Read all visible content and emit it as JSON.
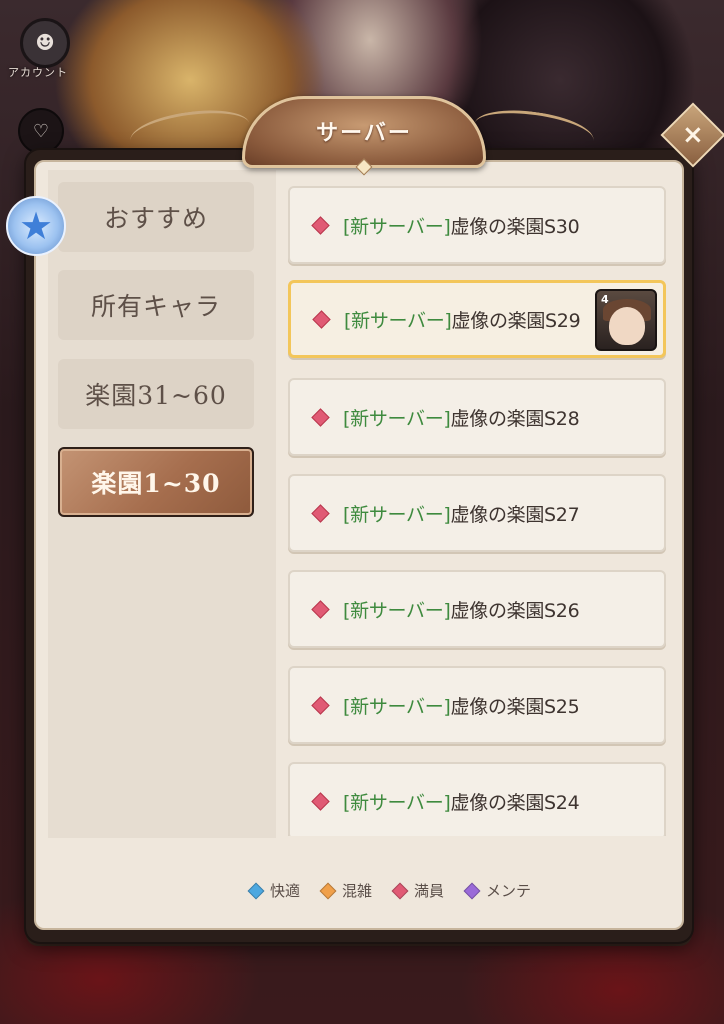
{
  "side": {
    "account_label": "アカウント",
    "heart_icon": "heart-icon",
    "star_icon": "star-icon"
  },
  "dialog": {
    "title": "サーバー",
    "close_label": "×"
  },
  "tabs": [
    {
      "label": "おすすめ",
      "active": false
    },
    {
      "label": "所有キャラ",
      "active": false
    },
    {
      "label": "楽園31~60",
      "active": false
    },
    {
      "label": "楽園1~30",
      "active": true
    }
  ],
  "servers": [
    {
      "tag": "[新サーバー]",
      "name": "虚像の楽園S30",
      "status": "full",
      "selected": false,
      "has_character": false
    },
    {
      "tag": "[新サーバー]",
      "name": "虚像の楽園S29",
      "status": "full",
      "selected": true,
      "has_character": true,
      "character_level": "4"
    },
    {
      "tag": "[新サーバー]",
      "name": "虚像の楽園S28",
      "status": "full",
      "selected": false,
      "has_character": false
    },
    {
      "tag": "[新サーバー]",
      "name": "虚像の楽園S27",
      "status": "full",
      "selected": false,
      "has_character": false
    },
    {
      "tag": "[新サーバー]",
      "name": "虚像の楽園S26",
      "status": "full",
      "selected": false,
      "has_character": false
    },
    {
      "tag": "[新サーバー]",
      "name": "虚像の楽園S25",
      "status": "full",
      "selected": false,
      "has_character": false
    },
    {
      "tag": "[新サーバー]",
      "name": "虚像の楽園S24",
      "status": "full",
      "selected": false,
      "has_character": false
    }
  ],
  "legend": [
    {
      "label": "快適",
      "color": "#4da8e0"
    },
    {
      "label": "混雑",
      "color": "#f0a04a"
    },
    {
      "label": "満員",
      "color": "#e05a74"
    },
    {
      "label": "メンテ",
      "color": "#9a6ad8"
    }
  ],
  "colors": {
    "status_full": "#e05a74",
    "new_tag": "#3e8a3e",
    "selected_border": "#f3c65a"
  }
}
